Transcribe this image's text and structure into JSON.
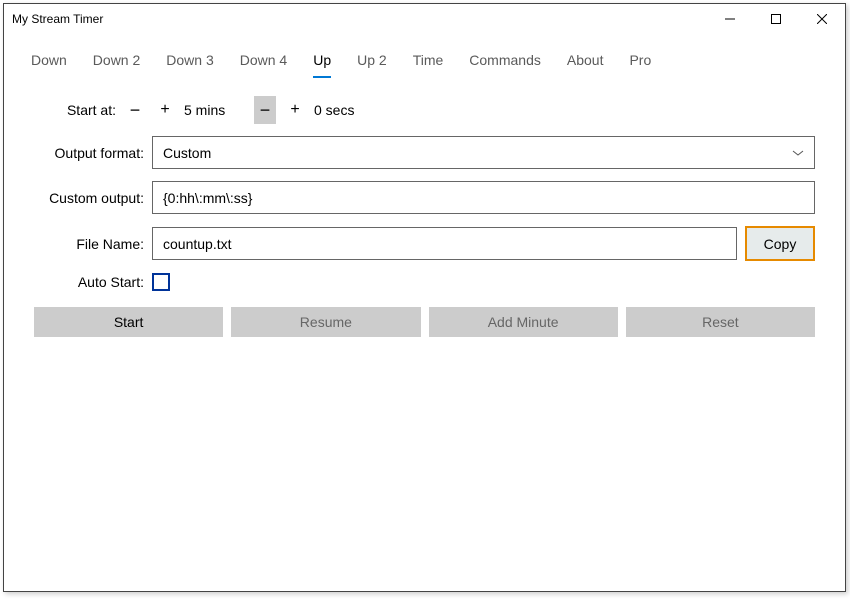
{
  "window": {
    "title": "My Stream Timer"
  },
  "tabs": [
    "Down",
    "Down 2",
    "Down 3",
    "Down 4",
    "Up",
    "Up 2",
    "Time",
    "Commands",
    "About",
    "Pro"
  ],
  "active_tab_index": 4,
  "form": {
    "start_at_label": "Start at:",
    "mins_value": "5 mins",
    "secs_value": "0 secs",
    "output_format_label": "Output format:",
    "output_format_value": "Custom",
    "custom_output_label": "Custom output:",
    "custom_output_value": "{0:hh\\:mm\\:ss}",
    "file_name_label": "File Name:",
    "file_name_value": "countup.txt",
    "copy_label": "Copy",
    "auto_start_label": "Auto Start:",
    "auto_start_checked": false
  },
  "buttons": {
    "start": "Start",
    "resume": "Resume",
    "add_minute": "Add Minute",
    "reset": "Reset"
  },
  "icons": {
    "minus": "−",
    "plus": "+",
    "minimize": "—",
    "chevron": "⌄"
  }
}
